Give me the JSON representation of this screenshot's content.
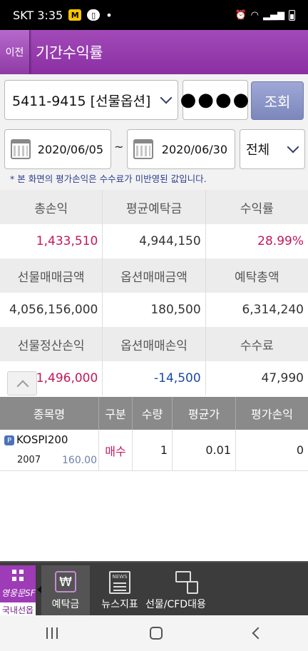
{
  "status_bar": {
    "carrier_time": "SKT 3:35",
    "m_badge": "M",
    "dot": "•"
  },
  "header": {
    "back_label": "이전",
    "title": "기간수익률"
  },
  "query": {
    "account": "5411-9415 [선물옵션]",
    "password_mask": "●●●●",
    "query_button": "조회"
  },
  "period": {
    "start_date": "2020/06/05",
    "separator": "~",
    "end_date": "2020/06/30",
    "type_filter": "전체",
    "note": "* 본 화면의 평가손익은 수수료가 미반영된 값입니다."
  },
  "summary": {
    "rows": [
      {
        "labels": [
          "총손익",
          "평균예탁금",
          "수익률"
        ],
        "values": [
          "1,433,510",
          "4,944,150",
          "28.99%"
        ]
      },
      {
        "labels": [
          "선물매매금액",
          "옵션매매금액",
          "예탁총액"
        ],
        "values": [
          "4,056,156,000",
          "180,500",
          "6,314,240"
        ]
      },
      {
        "labels": [
          "선물정산손익",
          "옵션매매손익",
          "수수료"
        ],
        "values": [
          "1,496,000",
          "-14,500",
          "47,990"
        ]
      }
    ]
  },
  "table": {
    "headers": [
      "종목명",
      "구분",
      "수량",
      "평균가",
      "평가손익"
    ],
    "rows": [
      {
        "badge": "P",
        "name": "KOSPI200",
        "code": "2007",
        "price": "160.00",
        "side": "매수",
        "qty": "1",
        "avg_price": "0.01",
        "pnl": "0"
      }
    ]
  },
  "bottom_nav": {
    "menu_brand": "영웅문SF",
    "menu_sub": "국내선옵",
    "tabs": [
      {
        "label": "예탁금",
        "icon": "won-icon",
        "active": true,
        "glyph": "₩"
      },
      {
        "label": "뉴스지표",
        "icon": "news-icon",
        "active": false,
        "glyph": "NEWS"
      },
      {
        "label": "선물/CFD대용",
        "icon": "cfd-icon",
        "active": false
      }
    ]
  },
  "colors": {
    "header": "#8b2fa3",
    "profit": "#c2185b",
    "loss": "#1a4aa8",
    "query_button": "#8a94c8"
  }
}
